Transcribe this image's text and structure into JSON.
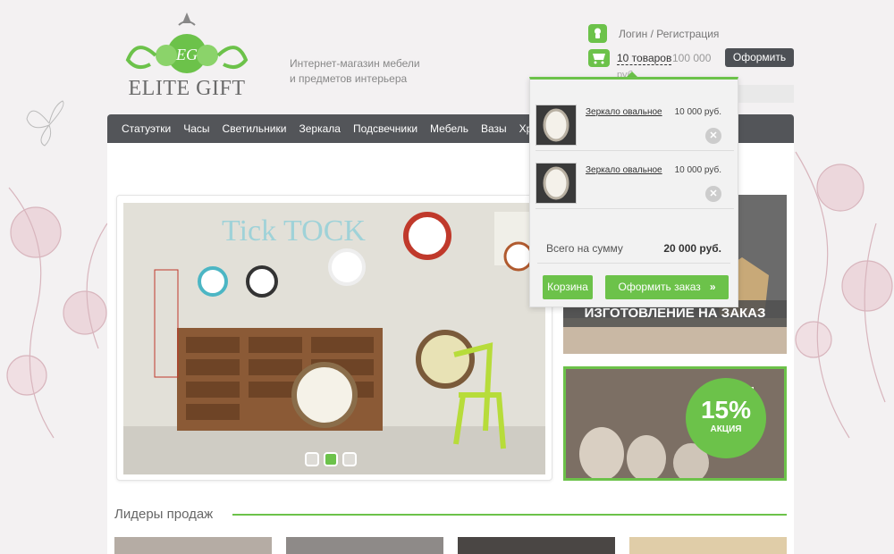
{
  "header": {
    "logo_text": "ELITE GIFT",
    "logo_monogram": "EG",
    "tagline_line1": "Интернет-магазин мебели",
    "tagline_line2": "и предметов интерьера",
    "login_text": "Логин / Регистрация",
    "cart_count": "10 товаров",
    "cart_sum": "100 000",
    "cart_sum_unit": "руб.",
    "checkout_label": "Оформить"
  },
  "nav": {
    "items": [
      "Статуэтки",
      "Часы",
      "Светильники",
      "Зеркала",
      "Подсвечники",
      "Мебель",
      "Вазы",
      "Хрусталь"
    ]
  },
  "slider": {
    "slide_text": "Tick TOCK",
    "active_dot": 2
  },
  "banners": {
    "custom_order": "ИЗГОТОВЛЕНИЕ НА ЗАКАЗ",
    "promo_percent": "15%",
    "promo_label": "АКЦИЯ"
  },
  "bestsellers": {
    "title": "Лидеры продаж"
  },
  "cart_dropdown": {
    "items": [
      {
        "name": "Зеркало овальное",
        "price": "10 000 руб."
      },
      {
        "name": "Зеркало овальное",
        "price": "10 000 руб."
      }
    ],
    "total_label": "Всего на сумму",
    "total_value": "20 000 руб.",
    "cart_button": "Корзина",
    "order_button": "Оформить заказ"
  },
  "colors": {
    "accent": "#6cc24a",
    "nav_bg": "#535559",
    "background": "#f3f1f2"
  }
}
